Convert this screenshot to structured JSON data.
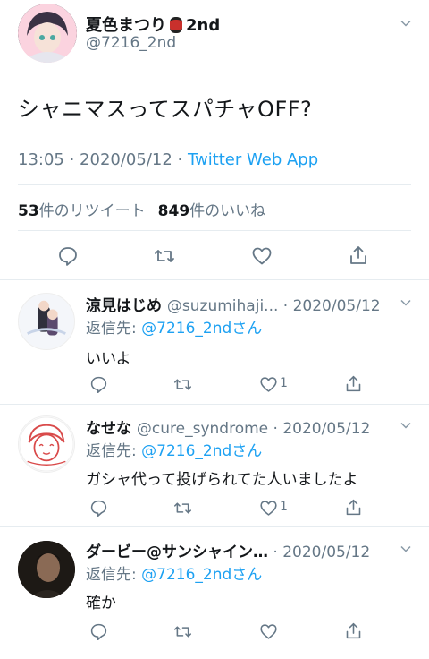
{
  "main_tweet": {
    "display_name": "夏色まつり",
    "display_name_suffix": "2nd",
    "handle": "@7216_2nd",
    "text": "シャニマスってスパチャOFF?",
    "time": "13:05 · 2020/05/12 · ",
    "source": "Twitter Web App",
    "retweet_count": "53",
    "retweet_label": "件のリツイート",
    "like_count": "849",
    "like_label": "件のいいね"
  },
  "replies": [
    {
      "display_name": "涼見はじめ",
      "handle": "@suzumihaji...",
      "date": " · 2020/05/12",
      "reply_prefix": "返信先: ",
      "reply_to": "@7216_2ndさん",
      "text": "いいよ",
      "like_count": "1"
    },
    {
      "display_name": "なせな",
      "handle": "@cure_syndrome",
      "date": " · 2020/05/12",
      "reply_prefix": "返信先: ",
      "reply_to": "@7216_2ndさん",
      "text": "ガシャ代って投げられてた人いましたよ",
      "like_count": "1"
    },
    {
      "display_name": "ダービー@サンシャイン…",
      "handle": "",
      "date": " · 2020/05/12",
      "reply_prefix": "返信先: ",
      "reply_to": "@7216_2ndさん",
      "text": "確か",
      "like_count": ""
    }
  ],
  "colors": {
    "accent": "#1da1f2",
    "secondary_text": "#657786",
    "divider": "#e6ecf0"
  }
}
